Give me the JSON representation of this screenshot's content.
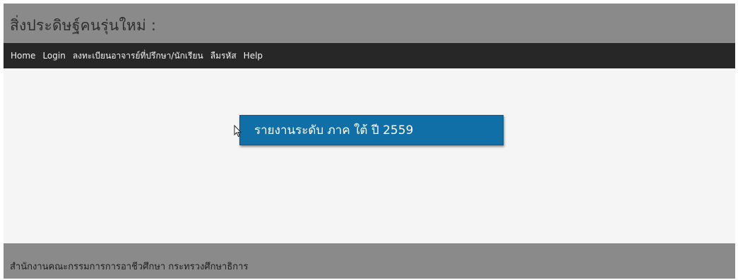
{
  "header": {
    "site_title": "สิ่งประดิษฐ์คนรุ่นใหม่ :"
  },
  "navbar": {
    "items": [
      {
        "label": "Home"
      },
      {
        "label": "Login"
      },
      {
        "label": "ลงทะเบียนอาจารย์ที่ปรึกษา/นักเรียน"
      },
      {
        "label": "ลืมรหัส"
      },
      {
        "label": "Help"
      }
    ]
  },
  "main": {
    "report_button_label": "รายงานระดับ ภาค ใต้ ปี 2559"
  },
  "footer": {
    "text": "สำนักงานคณะกรรมการการอาชีวศึกษา กระทรวงศึกษาธิการ"
  },
  "colors": {
    "header_bg": "#8a8a8a",
    "navbar_bg": "#272727",
    "button_bg": "#0f6fa6",
    "content_bg": "#f5f5f5"
  }
}
